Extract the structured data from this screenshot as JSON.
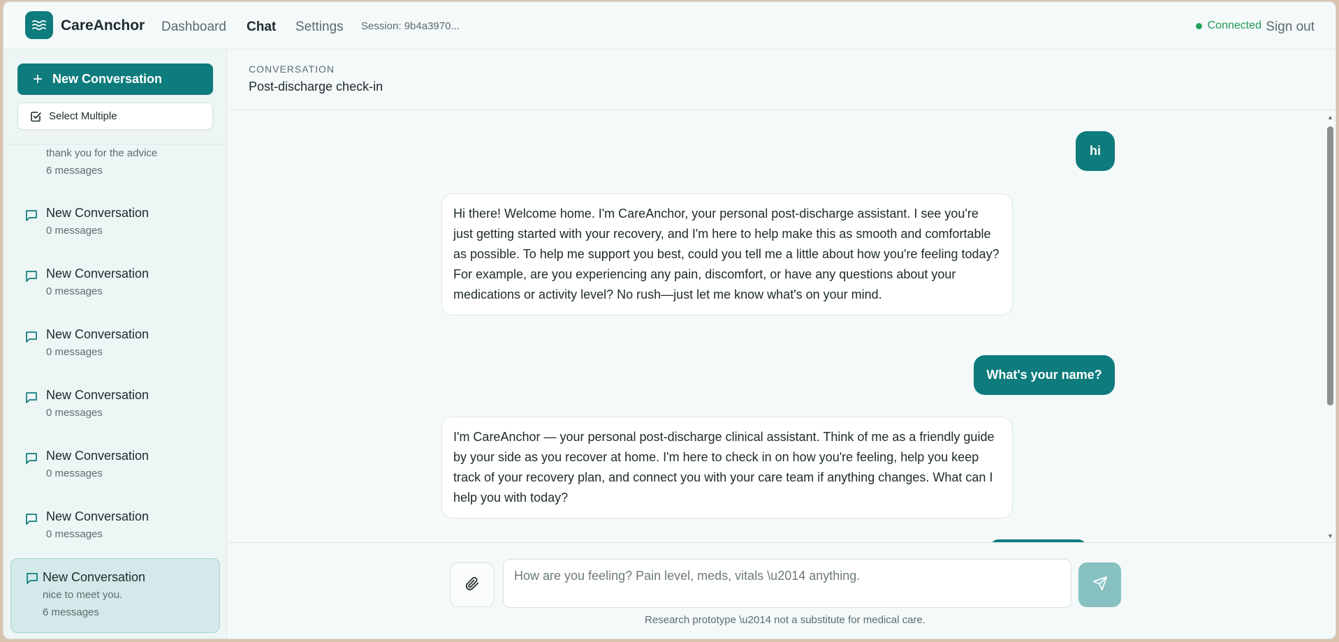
{
  "header": {
    "brand": "CareAnchor",
    "nav": [
      {
        "label": "Dashboard",
        "active": false
      },
      {
        "label": "Chat",
        "active": true
      },
      {
        "label": "Settings",
        "active": false
      }
    ],
    "session": "Session: 9b4a3970...",
    "status": "Connected",
    "sign_out": "Sign out"
  },
  "sidebar": {
    "new_conversation": "New Conversation",
    "select_multiple": "Select Multiple",
    "conversations": [
      {
        "title": "",
        "preview": "thank you for the advice",
        "count": "6 messages"
      },
      {
        "title": "New Conversation",
        "count": "0 messages"
      },
      {
        "title": "New Conversation",
        "count": "0 messages"
      },
      {
        "title": "New Conversation",
        "count": "0 messages"
      },
      {
        "title": "New Conversation",
        "count": "0 messages"
      },
      {
        "title": "New Conversation",
        "count": "0 messages"
      },
      {
        "title": "New Conversation",
        "count": "0 messages"
      },
      {
        "title": "New Conversation",
        "preview": "nice to meet you.",
        "count": "6 messages",
        "selected": true
      }
    ]
  },
  "conversation": {
    "label": "CONVERSATION",
    "title": "Post-discharge check-in",
    "messages": [
      {
        "role": "user",
        "text": "hi"
      },
      {
        "role": "assistant",
        "text": "Hi there! Welcome home. I'm CareAnchor, your personal post-discharge assistant. I see you're just getting started with your recovery, and I'm here to help make this as smooth and comfortable as possible. To help me support you best, could you tell me a little about how you're feeling today? For example, are you experiencing any pain, discomfort, or have any questions about your medications or activity level? No rush—just let me know what's on your mind."
      },
      {
        "role": "user",
        "text": "What's your name?"
      },
      {
        "role": "assistant",
        "text": "I'm CareAnchor — your personal post-discharge clinical assistant. Think of me as a friendly guide by your side as you recover at home. I'm here to check in on how you're feeling, help you keep track of your recovery plan, and connect you with your care team if anything changes. What can I help you with today?"
      }
    ]
  },
  "composer": {
    "placeholder": "How are you feeling? Pain level, meds, vitals \\u2014 anything.",
    "value": "",
    "disclaimer": "Research prototype \\u2014 not a substitute for medical care."
  },
  "colors": {
    "accent": "#0e7b7c",
    "send_disabled": "#86c0c1",
    "status_green": "#22a55e",
    "selected_item_bg": "#d4eaea"
  },
  "icons": [
    "waves-logo-icon",
    "plus-icon",
    "checkbox-icon",
    "chat-bubble-icon",
    "paperclip-icon",
    "send-icon"
  ]
}
